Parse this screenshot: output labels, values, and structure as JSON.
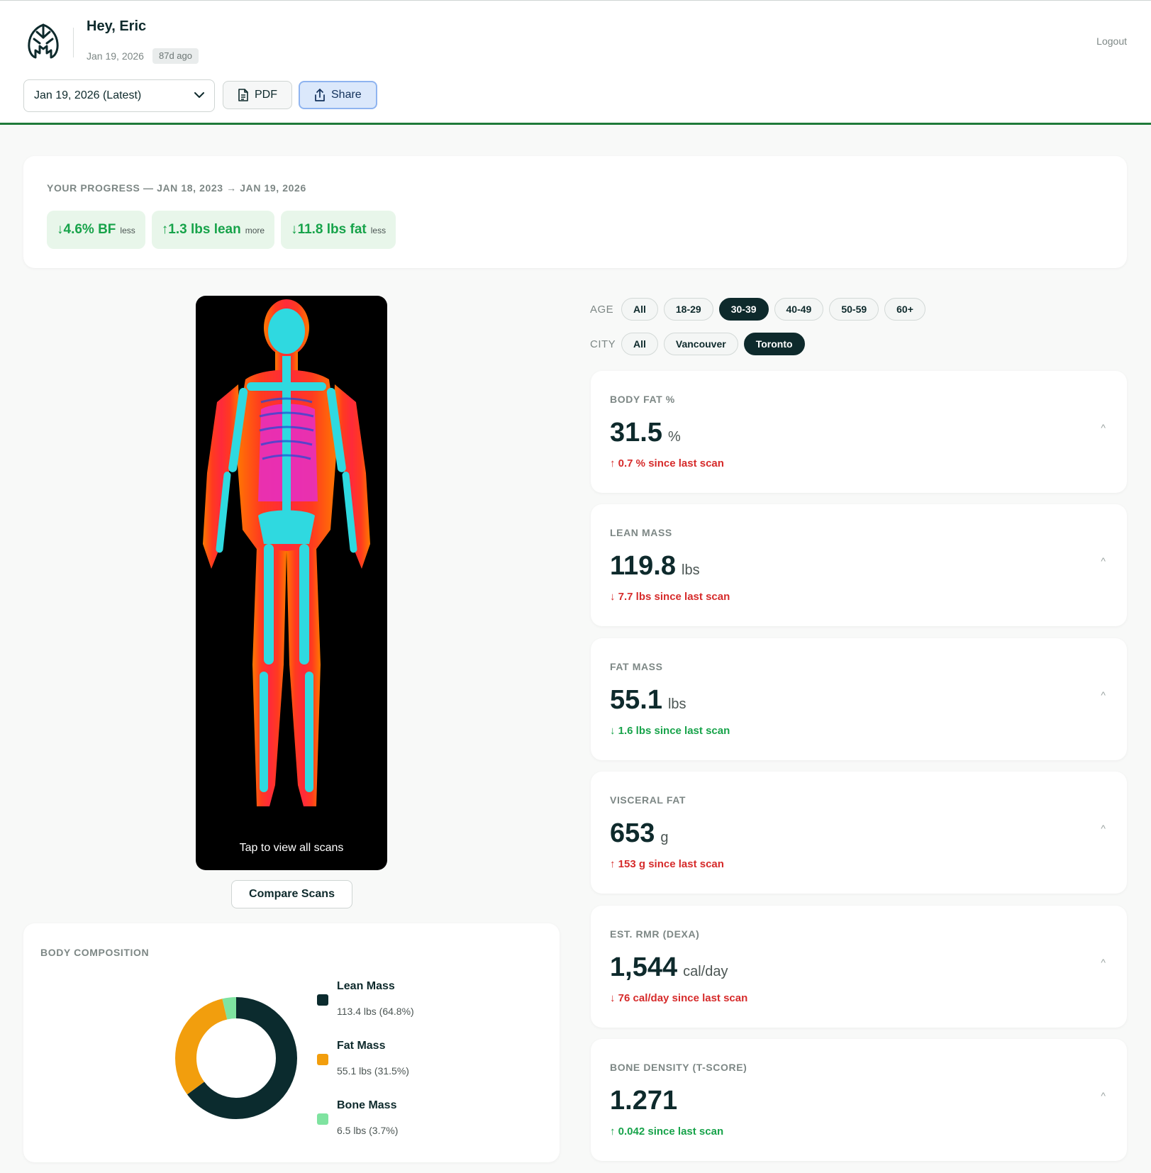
{
  "header": {
    "greeting": "Hey, Eric",
    "date": "Jan 19, 2026",
    "ago": "87d ago",
    "logout": "Logout",
    "scan_select": "Jan 19, 2026 (Latest)",
    "pdf_label": "PDF",
    "share_label": "Share"
  },
  "progress": {
    "title": "YOUR PROGRESS — JAN 18, 2023 → JAN 19, 2026",
    "chips": [
      {
        "value": "↓4.6% BF",
        "word": "less"
      },
      {
        "value": "↑1.3 lbs lean",
        "word": "more"
      },
      {
        "value": "↓11.8 lbs fat",
        "word": "less"
      }
    ]
  },
  "scan": {
    "caption": "Tap to view all scans",
    "compare_label": "Compare Scans"
  },
  "composition": {
    "title": "BODY COMPOSITION",
    "items": [
      {
        "name": "Lean Mass",
        "value": "113.4 lbs (64.8%)",
        "color": "#0b2b2e",
        "percent": 64.8
      },
      {
        "name": "Fat Mass",
        "value": "55.1 lbs (31.5%)",
        "color": "#f29e0d",
        "percent": 31.5
      },
      {
        "name": "Bone Mass",
        "value": "6.5 lbs (3.7%)",
        "color": "#7fe3a0",
        "percent": 3.7
      }
    ]
  },
  "filters": {
    "age_label": "AGE",
    "age_options": [
      "All",
      "18-29",
      "30-39",
      "40-49",
      "50-59",
      "60+"
    ],
    "age_selected": "30-39",
    "city_label": "CITY",
    "city_options": [
      "All",
      "Vancouver",
      "Toronto"
    ],
    "city_selected": "Toronto"
  },
  "metrics": [
    {
      "label": "BODY FAT %",
      "value": "31.5",
      "unit": "%",
      "change": "↑ 0.7 % since last scan",
      "trend": "red"
    },
    {
      "label": "LEAN MASS",
      "value": "119.8",
      "unit": "lbs",
      "change": "↓ 7.7 lbs since last scan",
      "trend": "red"
    },
    {
      "label": "FAT MASS",
      "value": "55.1",
      "unit": "lbs",
      "change": "↓ 1.6 lbs since last scan",
      "trend": "green"
    },
    {
      "label": "VISCERAL FAT",
      "value": "653",
      "unit": "g",
      "change": "↑ 153 g since last scan",
      "trend": "red"
    },
    {
      "label": "EST. RMR (DEXA)",
      "value": "1,544",
      "unit": "cal/day",
      "change": "↓ 76 cal/day since last scan",
      "trend": "red"
    },
    {
      "label": "BONE DENSITY (T-SCORE)",
      "value": "1.271",
      "unit": "",
      "change": "↑ 0.042 since last scan",
      "trend": "green"
    }
  ],
  "colors": {
    "accent_green": "#1f7a3a",
    "positive": "#17a34a",
    "negative": "#d62b2b",
    "dark": "#0e2a2c",
    "share_bg": "#dbe8fb"
  },
  "icons": [
    "brand-logo-icon",
    "chevron-down-icon",
    "document-icon",
    "share-icon",
    "chevron-up-icon"
  ]
}
